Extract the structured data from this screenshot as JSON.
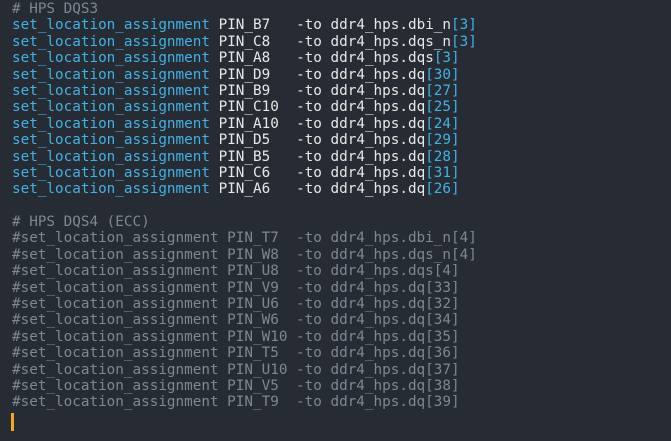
{
  "section1": {
    "header": "# HPS DQS3",
    "lines": [
      {
        "cmd": "set_location_assignment",
        "pin": "PIN_B7 ",
        "opt": "-to",
        "target": "ddr4_hps.dbi_n",
        "idx": "[3]"
      },
      {
        "cmd": "set_location_assignment",
        "pin": "PIN_C8 ",
        "opt": "-to",
        "target": "ddr4_hps.dqs_n",
        "idx": "[3]"
      },
      {
        "cmd": "set_location_assignment",
        "pin": "PIN_A8 ",
        "opt": "-to",
        "target": "ddr4_hps.dqs",
        "idx": "[3]"
      },
      {
        "cmd": "set_location_assignment",
        "pin": "PIN_D9 ",
        "opt": "-to",
        "target": "ddr4_hps.dq",
        "idx": "[30]"
      },
      {
        "cmd": "set_location_assignment",
        "pin": "PIN_B9 ",
        "opt": "-to",
        "target": "ddr4_hps.dq",
        "idx": "[27]"
      },
      {
        "cmd": "set_location_assignment",
        "pin": "PIN_C10",
        "opt": "-to",
        "target": "ddr4_hps.dq",
        "idx": "[25]"
      },
      {
        "cmd": "set_location_assignment",
        "pin": "PIN_A10",
        "opt": "-to",
        "target": "ddr4_hps.dq",
        "idx": "[24]"
      },
      {
        "cmd": "set_location_assignment",
        "pin": "PIN_D5 ",
        "opt": "-to",
        "target": "ddr4_hps.dq",
        "idx": "[29]"
      },
      {
        "cmd": "set_location_assignment",
        "pin": "PIN_B5 ",
        "opt": "-to",
        "target": "ddr4_hps.dq",
        "idx": "[28]"
      },
      {
        "cmd": "set_location_assignment",
        "pin": "PIN_C6 ",
        "opt": "-to",
        "target": "ddr4_hps.dq",
        "idx": "[31]"
      },
      {
        "cmd": "set_location_assignment",
        "pin": "PIN_A6 ",
        "opt": "-to",
        "target": "ddr4_hps.dq",
        "idx": "[26]"
      }
    ]
  },
  "section2": {
    "header": "# HPS DQS4 (ECC)",
    "lines": [
      "#set_location_assignment PIN_T7  -to ddr4_hps.dbi_n[4]",
      "#set_location_assignment PIN_W8  -to ddr4_hps.dqs_n[4]",
      "#set_location_assignment PIN_U8  -to ddr4_hps.dqs[4]",
      "#set_location_assignment PIN_V9  -to ddr4_hps.dq[33]",
      "#set_location_assignment PIN_U6  -to ddr4_hps.dq[32]",
      "#set_location_assignment PIN_W6  -to ddr4_hps.dq[34]",
      "#set_location_assignment PIN_W10 -to ddr4_hps.dq[35]",
      "#set_location_assignment PIN_T5  -to ddr4_hps.dq[36]",
      "#set_location_assignment PIN_U10 -to ddr4_hps.dq[37]",
      "#set_location_assignment PIN_V5  -to ddr4_hps.dq[38]",
      "#set_location_assignment PIN_T9  -to ddr4_hps.dq[39]"
    ]
  },
  "colors": {
    "background": "#272b33",
    "command": "#3fb3e6",
    "comment": "#7f8794",
    "text": "#e8e8e8",
    "cursor": "#f2a81f"
  }
}
